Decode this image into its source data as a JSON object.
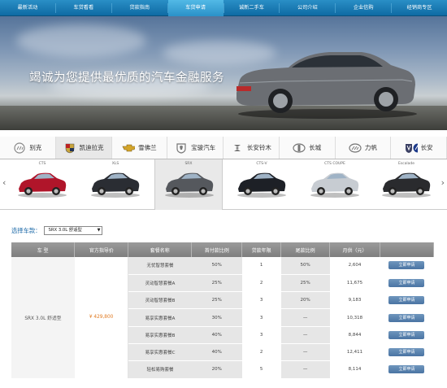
{
  "nav": {
    "items": [
      "最新活动",
      "车贷看看",
      "贷款指南",
      "车贷申请",
      "诚新二手车",
      "公司介绍",
      "企业信购",
      "经销商专区"
    ],
    "active_index": 3
  },
  "banner": {
    "slogan": "竭诚为您提供最优质的汽车金融服务"
  },
  "brands": {
    "items": [
      {
        "label": "别克",
        "icon": "buick-logo-icon"
      },
      {
        "label": "凯迪拉克",
        "icon": "cadillac-logo-icon"
      },
      {
        "label": "雪佛兰",
        "icon": "chevrolet-logo-icon"
      },
      {
        "label": "宝骏汽车",
        "icon": "baojun-logo-icon"
      },
      {
        "label": "长安铃木",
        "icon": "suzuki-logo-icon"
      },
      {
        "label": "长城",
        "icon": "greatwall-logo-icon"
      },
      {
        "label": "力帆",
        "icon": "lifan-logo-icon"
      },
      {
        "label": "长安",
        "icon": "changan-logo-icon"
      }
    ],
    "active_index": 1
  },
  "cars": {
    "items": [
      {
        "name": "CTS",
        "color": "#b0152a"
      },
      {
        "name": "XLS",
        "color": "#2a2d33"
      },
      {
        "name": "SRX",
        "color": "#55585d"
      },
      {
        "name": "CTS-V",
        "color": "#1d2026"
      },
      {
        "name": "CTS COUPE",
        "color": "#c7ccd2"
      },
      {
        "name": "Escalade",
        "color": "#2a2b2e"
      }
    ],
    "active_index": 2
  },
  "selector": {
    "label": "选择车款：",
    "value": "SRX 3.0L 舒适型"
  },
  "table": {
    "headers": [
      "车 型",
      "官方指导价",
      "套餐名称",
      "首付款比例",
      "贷款年限",
      "尾款比例",
      "月供（元）",
      ""
    ],
    "model": "SRX 3.0L 舒适型",
    "price": "¥ 429,800",
    "apply_label": "立即申请",
    "rows": [
      {
        "plan": "无忧智慧套餐",
        "down": "50%",
        "term": "1",
        "final": "50%",
        "monthly": "2,604"
      },
      {
        "plan": "灵动智慧套餐A",
        "down": "25%",
        "term": "2",
        "final": "25%",
        "monthly": "11,675"
      },
      {
        "plan": "灵动智慧套餐B",
        "down": "25%",
        "term": "3",
        "final": "20%",
        "monthly": "9,183"
      },
      {
        "plan": "易享实惠套餐A",
        "down": "30%",
        "term": "3",
        "final": "—",
        "monthly": "10,318"
      },
      {
        "plan": "易享实惠套餐B",
        "down": "40%",
        "term": "3",
        "final": "—",
        "monthly": "8,844"
      },
      {
        "plan": "易享实惠套餐C",
        "down": "40%",
        "term": "2",
        "final": "—",
        "monthly": "12,411"
      },
      {
        "plan": "轻松易购套餐",
        "down": "20%",
        "term": "5",
        "final": "—",
        "monthly": "8,114"
      }
    ]
  }
}
